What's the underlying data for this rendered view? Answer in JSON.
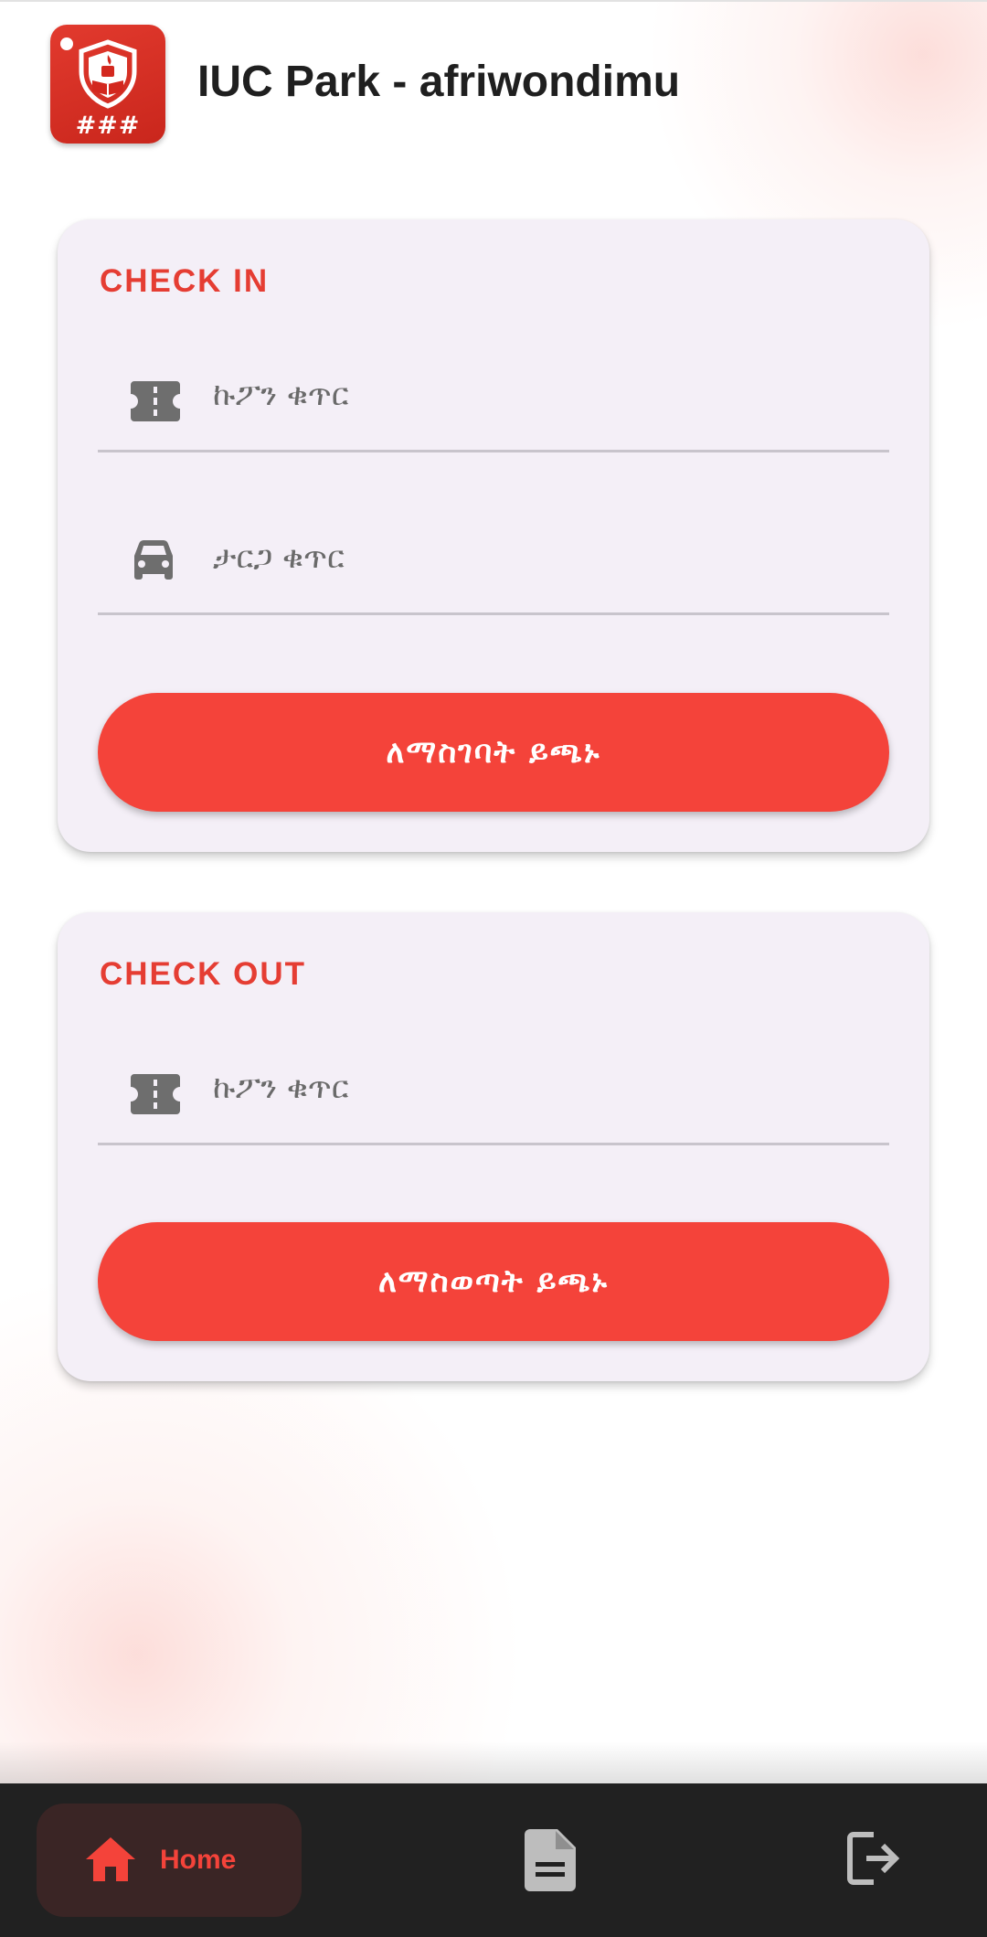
{
  "header": {
    "logo_text": "###",
    "title": "IUC Park - afriwondimu"
  },
  "check_in": {
    "title": "CHECK IN",
    "coupon_icon": "ticket-icon",
    "coupon_placeholder": "ኩፖን ቁጥር",
    "plate_icon": "car-icon",
    "plate_placeholder": "ታርጋ ቁጥር",
    "submit_label": "ለማስገባት ይጫኑ"
  },
  "check_out": {
    "title": "CHECK OUT",
    "coupon_icon": "ticket-icon",
    "coupon_placeholder": "ኩፖን ቁጥር",
    "submit_label": "ለማስወጣት ይጫኑ"
  },
  "bottom_nav": {
    "items": [
      {
        "icon": "home-icon",
        "label": "Home",
        "active": true
      },
      {
        "icon": "document-icon",
        "label": "",
        "active": false
      },
      {
        "icon": "logout-icon",
        "label": "",
        "active": false
      }
    ]
  },
  "colors": {
    "accent": "#f4433a",
    "card_bg": "#f4eff7",
    "nav_bg": "#212121",
    "nav_active_bg": "#3a2525"
  }
}
